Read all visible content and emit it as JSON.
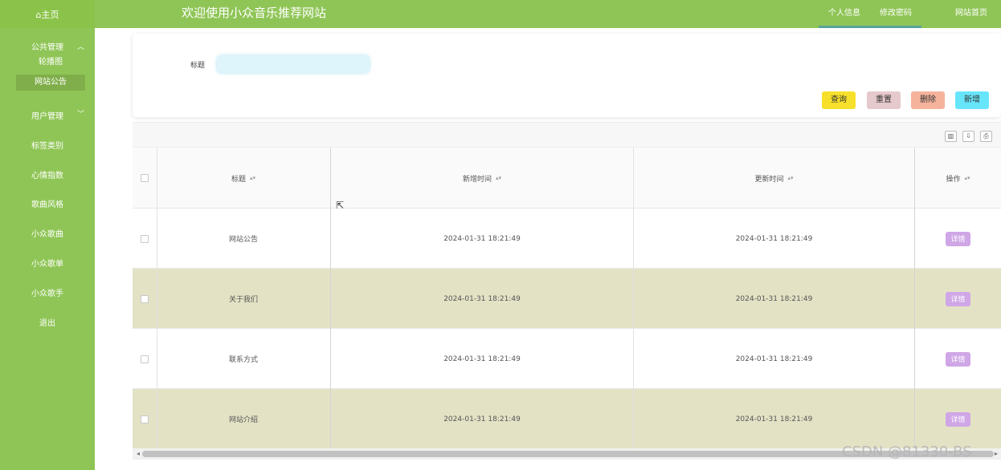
{
  "header": {
    "home_label": "⌂主页",
    "site_title": "欢迎使用小众音乐推荐网站",
    "links": [
      "个人信息",
      "修改密码",
      "网站首页"
    ]
  },
  "sidebar": {
    "public_mgmt": "公共管理",
    "public_sub": [
      "轮播图",
      "网站公告"
    ],
    "user_mgmt": "用户管理",
    "items": [
      "标签类别",
      "心情指数",
      "歌曲风格",
      "小众歌曲",
      "小众歌单",
      "小众歌手",
      "退出"
    ]
  },
  "search": {
    "label": "标题",
    "input_value": "",
    "buttons": [
      "查询",
      "重置",
      "删除",
      "新增"
    ]
  },
  "colors": {
    "accent": "#8fc556",
    "query_btn": "#f7e02b",
    "reset_btn": "#e6c9cc",
    "delete_btn": "#f5b39c",
    "add_btn": "#66e5fb",
    "detail_btn": "#cfa6e6",
    "alt_row": "#e3e2c5"
  },
  "toolbar_icons": [
    "columns-icon",
    "export-icon",
    "print-icon"
  ],
  "table": {
    "headers": [
      "标题",
      "新增时间",
      "更新时间",
      "操作"
    ],
    "rows": [
      {
        "title": "网站公告",
        "created": "2024-01-31 18:21:49",
        "updated": "2024-01-31 18:21:49",
        "action": "详情"
      },
      {
        "title": "关于我们",
        "created": "2024-01-31 18:21:49",
        "updated": "2024-01-31 18:21:49",
        "action": "详情"
      },
      {
        "title": "联系方式",
        "created": "2024-01-31 18:21:49",
        "updated": "2024-01-31 18:21:49",
        "action": "详情"
      },
      {
        "title": "网站介绍",
        "created": "2024-01-31 18:21:49",
        "updated": "2024-01-31 18:21:49",
        "action": "详情"
      }
    ]
  },
  "watermark": "CSDN @81330-BS"
}
